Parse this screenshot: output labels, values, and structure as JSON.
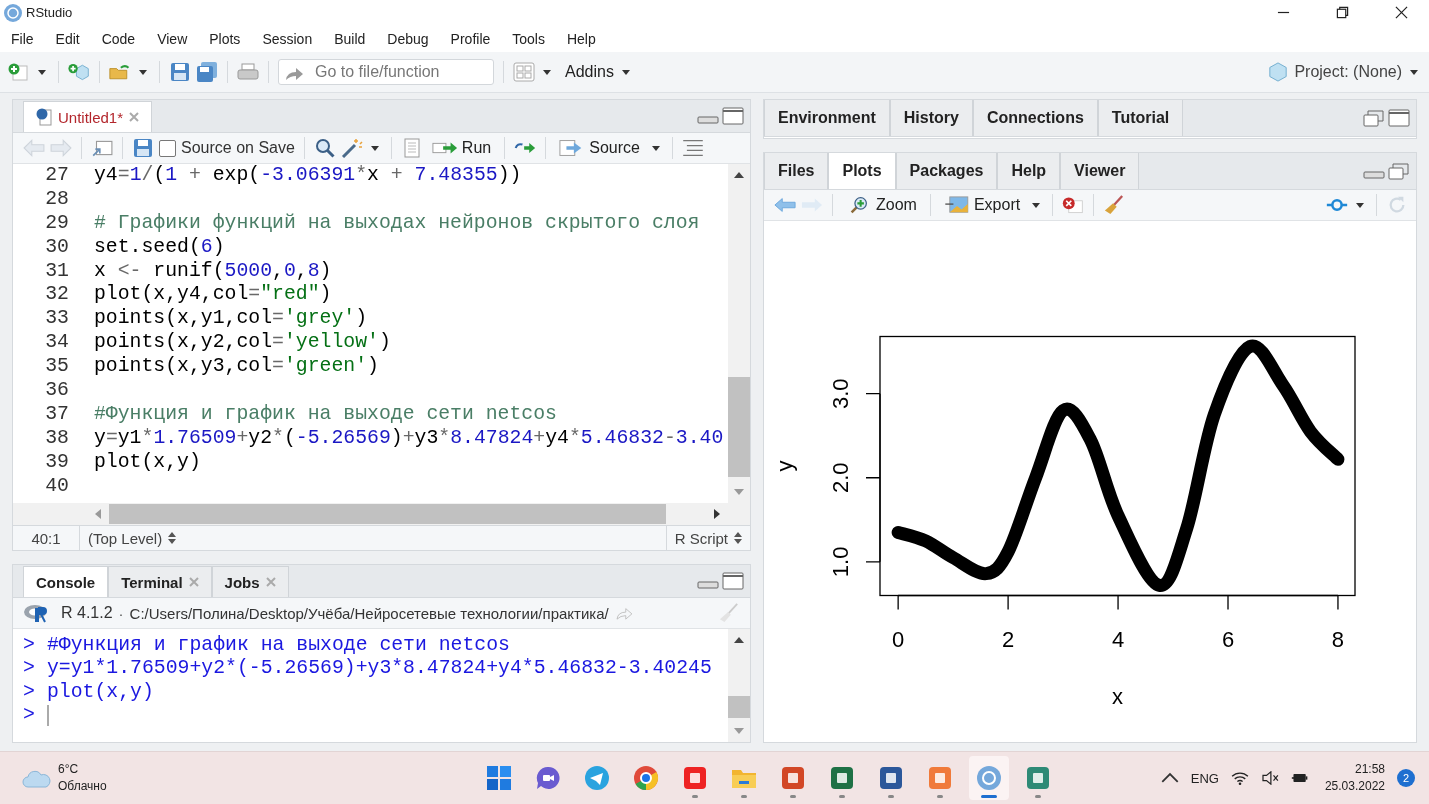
{
  "window": {
    "title": "RStudio"
  },
  "menu": [
    {
      "label": "File"
    },
    {
      "label": "Edit"
    },
    {
      "label": "Code"
    },
    {
      "label": "View"
    },
    {
      "label": "Plots"
    },
    {
      "label": "Session"
    },
    {
      "label": "Build"
    },
    {
      "label": "Debug"
    },
    {
      "label": "Profile"
    },
    {
      "label": "Tools"
    },
    {
      "label": "Help"
    }
  ],
  "toolbar": {
    "goto_placeholder": "Go to file/function",
    "addins": "Addins",
    "project": "Project: (None)"
  },
  "source_pane": {
    "tabs": [
      {
        "label": "Untitled1*",
        "selected": true,
        "modified": true
      }
    ],
    "source_on_save": {
      "label": "Source on Save",
      "checked": false
    },
    "run": "Run",
    "source": "Source",
    "lines": [
      {
        "number": "27",
        "tokens": [
          {
            "kind": "id",
            "text": "y4"
          },
          {
            "kind": "op",
            "text": "="
          },
          {
            "kind": "num",
            "text": "1"
          },
          {
            "kind": "op",
            "text": "/"
          },
          {
            "kind": "id",
            "text": "("
          },
          {
            "kind": "num",
            "text": "1"
          },
          {
            "kind": "op",
            "text": " + "
          },
          {
            "kind": "id",
            "text": "exp("
          },
          {
            "kind": "num",
            "text": "-3.06391"
          },
          {
            "kind": "op",
            "text": "*"
          },
          {
            "kind": "id",
            "text": "x"
          },
          {
            "kind": "op",
            "text": " + "
          },
          {
            "kind": "num",
            "text": "7.48355"
          },
          {
            "kind": "id",
            "text": "))"
          }
        ]
      },
      {
        "number": "28"
      },
      {
        "number": "29",
        "tokens": [
          {
            "kind": "comment",
            "text": "# Графики функций на выходах нейронов скрытого слоя"
          }
        ]
      },
      {
        "number": "30",
        "tokens": [
          {
            "kind": "id",
            "text": "set.seed("
          },
          {
            "kind": "num",
            "text": "6"
          },
          {
            "kind": "id",
            "text": ")"
          }
        ]
      },
      {
        "number": "31",
        "tokens": [
          {
            "kind": "id",
            "text": "x "
          },
          {
            "kind": "op",
            "text": "<-"
          },
          {
            "kind": "id",
            "text": " runif("
          },
          {
            "kind": "num",
            "text": "5000"
          },
          {
            "kind": "id",
            "text": ","
          },
          {
            "kind": "num",
            "text": "0"
          },
          {
            "kind": "id",
            "text": ","
          },
          {
            "kind": "num",
            "text": "8"
          },
          {
            "kind": "id",
            "text": ")"
          }
        ]
      },
      {
        "number": "32",
        "tokens": [
          {
            "kind": "id",
            "text": "plot(x,y4,col"
          },
          {
            "kind": "op",
            "text": "="
          },
          {
            "kind": "str",
            "text": "\"red\""
          },
          {
            "kind": "id",
            "text": ")"
          }
        ]
      },
      {
        "number": "33",
        "tokens": [
          {
            "kind": "id",
            "text": "points(x,y1,col"
          },
          {
            "kind": "op",
            "text": "="
          },
          {
            "kind": "str",
            "text": "'grey'"
          },
          {
            "kind": "id",
            "text": ")"
          }
        ]
      },
      {
        "number": "34",
        "tokens": [
          {
            "kind": "id",
            "text": "points(x,y2,col"
          },
          {
            "kind": "op",
            "text": "="
          },
          {
            "kind": "str",
            "text": "'yellow'"
          },
          {
            "kind": "id",
            "text": ")"
          }
        ]
      },
      {
        "number": "35",
        "tokens": [
          {
            "kind": "id",
            "text": "points(x,y3,col"
          },
          {
            "kind": "op",
            "text": "="
          },
          {
            "kind": "str",
            "text": "'green'"
          },
          {
            "kind": "id",
            "text": ")"
          }
        ]
      },
      {
        "number": "36"
      },
      {
        "number": "37",
        "tokens": [
          {
            "kind": "comment",
            "text": "#Функция и график на выходе сети netcos"
          }
        ]
      },
      {
        "number": "38",
        "tokens": [
          {
            "kind": "id",
            "text": "y"
          },
          {
            "kind": "op",
            "text": "="
          },
          {
            "kind": "id",
            "text": "y1"
          },
          {
            "kind": "op",
            "text": "*"
          },
          {
            "kind": "num",
            "text": "1.76509"
          },
          {
            "kind": "op",
            "text": "+"
          },
          {
            "kind": "id",
            "text": "y2"
          },
          {
            "kind": "op",
            "text": "*"
          },
          {
            "kind": "id",
            "text": "("
          },
          {
            "kind": "num",
            "text": "-5.26569"
          },
          {
            "kind": "id",
            "text": ")"
          },
          {
            "kind": "op",
            "text": "+"
          },
          {
            "kind": "id",
            "text": "y3"
          },
          {
            "kind": "op",
            "text": "*"
          },
          {
            "kind": "num",
            "text": "8.47824"
          },
          {
            "kind": "op",
            "text": "+"
          },
          {
            "kind": "id",
            "text": "y4"
          },
          {
            "kind": "op",
            "text": "*"
          },
          {
            "kind": "num",
            "text": "5.46832"
          },
          {
            "kind": "op",
            "text": "-"
          },
          {
            "kind": "num",
            "text": "3.40"
          }
        ]
      },
      {
        "number": "39",
        "tokens": [
          {
            "kind": "id",
            "text": "plot(x,y)"
          }
        ]
      },
      {
        "number": "40"
      }
    ],
    "status": {
      "position": "40:1",
      "scope": "(Top Level)",
      "file_type": "R Script"
    }
  },
  "console_pane": {
    "tabs": [
      {
        "label": "Console",
        "selected": true,
        "closable": false
      },
      {
        "label": "Terminal",
        "selected": false,
        "closable": true
      },
      {
        "label": "Jobs",
        "selected": false,
        "closable": true
      }
    ],
    "version": "R 4.1.2",
    "separator": "·",
    "path": "C:/Users/Полина/Desktop/Учёба/Нейросетевые технологии/практика/",
    "lines": [
      {
        "prompt": ">",
        "text": "#Функция и график на выходе сети netcos"
      },
      {
        "prompt": ">",
        "text": "y=y1*1.76509+y2*(-5.26569)+y3*8.47824+y4*5.46832-3.40245"
      },
      {
        "prompt": ">",
        "text": "plot(x,y)"
      },
      {
        "prompt": ">",
        "cursor": true
      }
    ]
  },
  "env_pane": {
    "tabs": [
      {
        "label": "Environment",
        "selected": false
      },
      {
        "label": "History",
        "selected": false
      },
      {
        "label": "Connections",
        "selected": false
      },
      {
        "label": "Tutorial",
        "selected": false
      }
    ]
  },
  "files_pane": {
    "tabs": [
      {
        "label": "Files",
        "selected": false
      },
      {
        "label": "Plots",
        "selected": true
      },
      {
        "label": "Packages",
        "selected": false
      },
      {
        "label": "Help",
        "selected": false
      },
      {
        "label": "Viewer",
        "selected": false
      }
    ],
    "zoom": "Zoom",
    "export": "Export",
    "chart_data": {
      "type": "line",
      "xlabel": "x",
      "ylabel": "y",
      "x": [
        0,
        0.5,
        1,
        1.6,
        2,
        2.5,
        3,
        3.5,
        4,
        4.75,
        5.25,
        5.75,
        6.4,
        7,
        7.5,
        8
      ],
      "series": [
        {
          "color": "#000000",
          "values": [
            1.35,
            1.25,
            1.05,
            0.86,
            1.12,
            2.0,
            2.8,
            2.45,
            1.55,
            0.72,
            1.4,
            2.75,
            3.56,
            3.1,
            2.55,
            2.22
          ]
        }
      ],
      "xlim": [
        -0.33,
        8.31
      ],
      "ylim": [
        0.6,
        3.68
      ],
      "xticks": [
        0,
        2,
        4,
        6,
        8
      ],
      "yticks": [
        {
          "value": 1,
          "label": "1.0"
        },
        {
          "value": 2,
          "label": "2.0"
        },
        {
          "value": 3,
          "label": "3.0"
        }
      ]
    }
  },
  "taskbar": {
    "temperature": "6°C",
    "weather": "Облачно",
    "apps": [
      {
        "kind": "start",
        "running": false,
        "active": false
      },
      {
        "kind": "chat",
        "running": false,
        "active": false
      },
      {
        "kind": "telegram",
        "running": false,
        "active": false
      },
      {
        "kind": "chrome",
        "running": false,
        "active": false
      },
      {
        "kind": "yandex",
        "running": true,
        "active": false
      },
      {
        "kind": "folder",
        "running": true,
        "active": false
      },
      {
        "kind": "powerpoint",
        "running": true,
        "active": false
      },
      {
        "kind": "excel",
        "running": true,
        "active": false
      },
      {
        "kind": "word",
        "running": true,
        "active": false
      },
      {
        "kind": "orange",
        "running": true,
        "active": false
      },
      {
        "kind": "rstudio",
        "running": true,
        "active": true
      },
      {
        "kind": "window",
        "running": true,
        "active": false
      }
    ],
    "language": "ENG",
    "time": "21:58",
    "date": "25.03.2022",
    "notifications": "2"
  }
}
